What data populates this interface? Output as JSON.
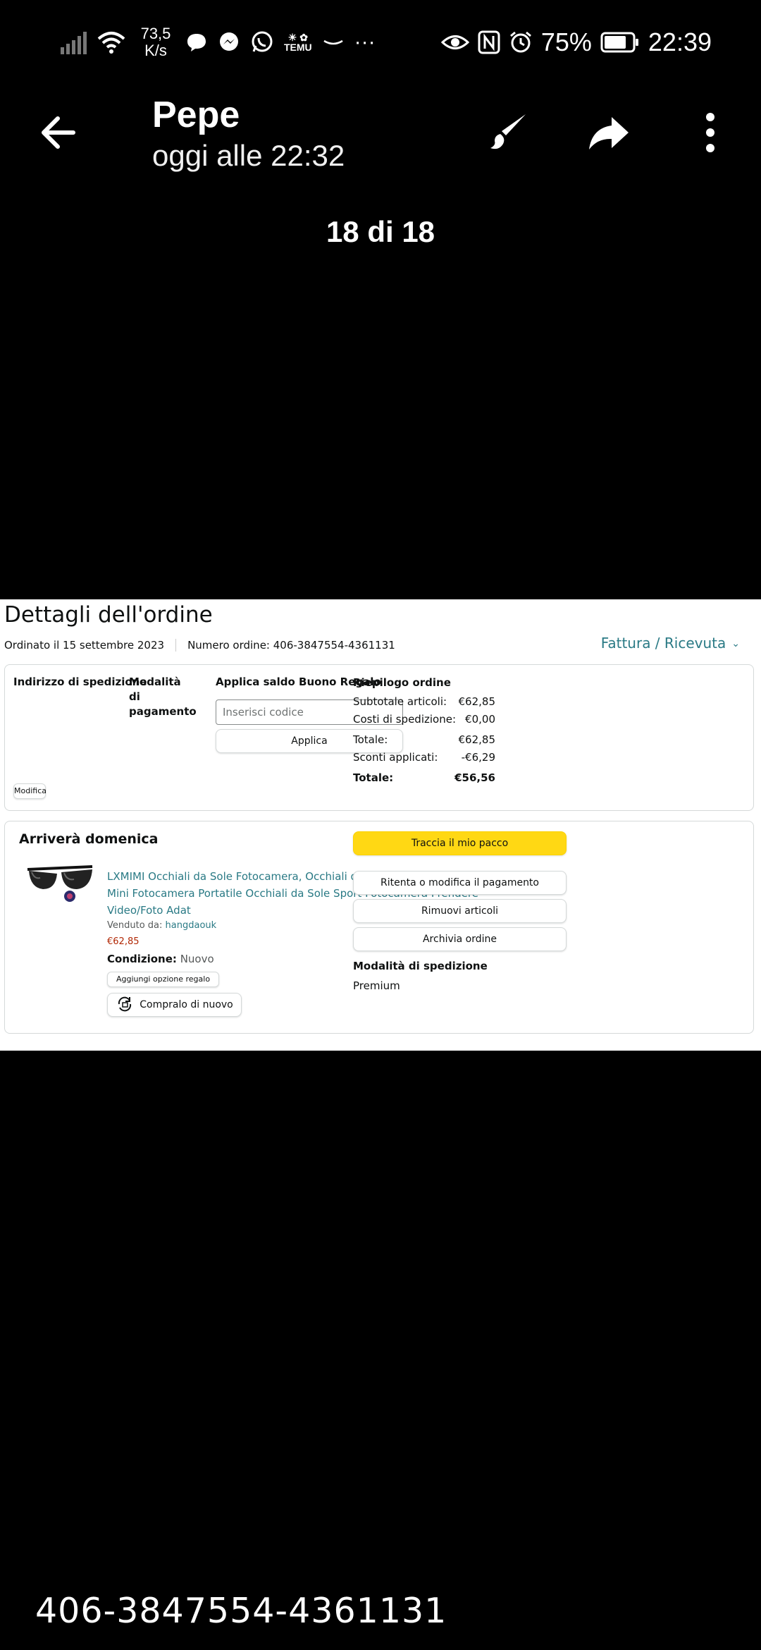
{
  "status_bar": {
    "net_speed_value": "73,5",
    "net_speed_unit": "K/s",
    "temu_icon_text": "TEMU",
    "battery": "75%",
    "time": "22:39"
  },
  "viewer": {
    "sender": "Pepe",
    "sent_time": "oggi alle 22:32",
    "counter": "18 di 18"
  },
  "order": {
    "title": "Dettagli dell'ordine",
    "ordered_on": "Ordinato il 15 settembre 2023",
    "order_number": "Numero ordine: 406-3847554-4361131",
    "invoice_link": "Fattura / Ricevuta",
    "shipping_address_label": "Indirizzo di spedizione",
    "payment_label": "Modalità di pagamento",
    "gift_balance_label": "Applica saldo Buono Regalo",
    "code_placeholder": "Inserisci codice",
    "apply_label": "Applica",
    "edit_label": "Modifica",
    "summary": {
      "title": "Riepilogo ordine",
      "rows": [
        {
          "label": "Subtotale articoli:",
          "value": "€62,85"
        },
        {
          "label": "Costi di spedizione:",
          "value": "€0,00"
        },
        {
          "label": "Totale:",
          "value": "€62,85"
        },
        {
          "label": "Sconti applicati:",
          "value": "-€6,29"
        },
        {
          "label": "Totale:",
          "value": "€56,56"
        }
      ]
    },
    "shipment": {
      "arrival": "Arriverà domenica",
      "product_title": "LXMIMI Occhiali da Sole Fotocamera, Occhiali da Sole con HD 1080P Mini Fotocamera Portatile Occhiali da Sole Sport Fotocamera Prendere Video/Foto Adat",
      "sold_by_label": "Venduto da:",
      "seller": "hangdaouk",
      "price": "€62,85",
      "condition_label": "Condizione:",
      "condition": "Nuovo",
      "gift_option": "Aggiungi opzione regalo",
      "buy_again": "Compralo di nuovo",
      "track": "Traccia il mio pacco",
      "retry_payment": "Ritenta o modifica il pagamento",
      "remove_items": "Rimuovi articoli",
      "archive": "Archivia ordine",
      "shipping_mode_label": "Modalità di spedizione",
      "shipping_mode": "Premium"
    },
    "colors": {
      "link": "#2a7a85",
      "price": "#b12704",
      "track_button": "#ffd814"
    }
  },
  "caption": "406-3847554-4361131"
}
